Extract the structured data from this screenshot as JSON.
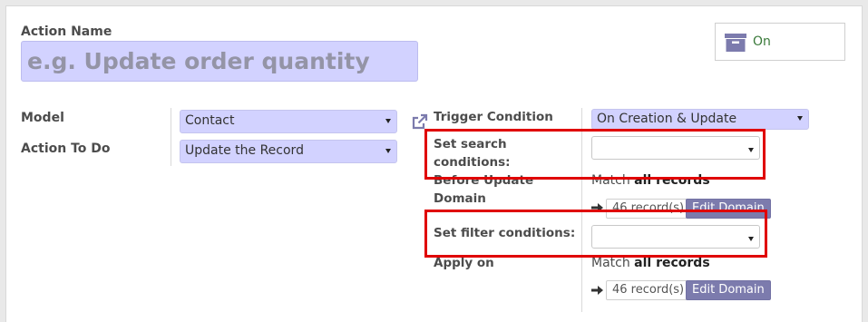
{
  "form": {
    "action_name_label": "Action Name",
    "action_name_placeholder": "e.g. Update order quantity",
    "active_status": "On",
    "model_label": "Model",
    "model_value": "Contact",
    "action_to_do_label": "Action To Do",
    "action_to_do_value": "Update the Record",
    "trigger_condition_label": "Trigger Condition",
    "trigger_condition_value": "On Creation & Update",
    "set_search_label_line1": "Set search",
    "set_search_label_line2": "conditions:",
    "before_update_label_line1": "Before Update",
    "before_update_label_line2": "Domain",
    "before_update_match_prefix": "Match",
    "before_update_match_scope": "all records",
    "before_update_record_count": "46 record(s)",
    "before_update_edit_label": "Edit Domain",
    "set_filter_label": "Set filter conditions:",
    "apply_on_label": "Apply on",
    "apply_on_match_prefix": "Match",
    "apply_on_match_scope": "all records",
    "apply_on_record_count": "46 record(s)",
    "apply_on_edit_label": "Edit Domain"
  },
  "icons": {
    "status": "archive-icon",
    "external": "external-link-icon",
    "arrow": "arrow-right-icon",
    "caret": "caret-down-icon"
  },
  "colors": {
    "required_field": "#d2d2ff",
    "primary_button": "#7c7bad",
    "highlight_box": "#e00000",
    "status_on": "#3a7a3a"
  }
}
